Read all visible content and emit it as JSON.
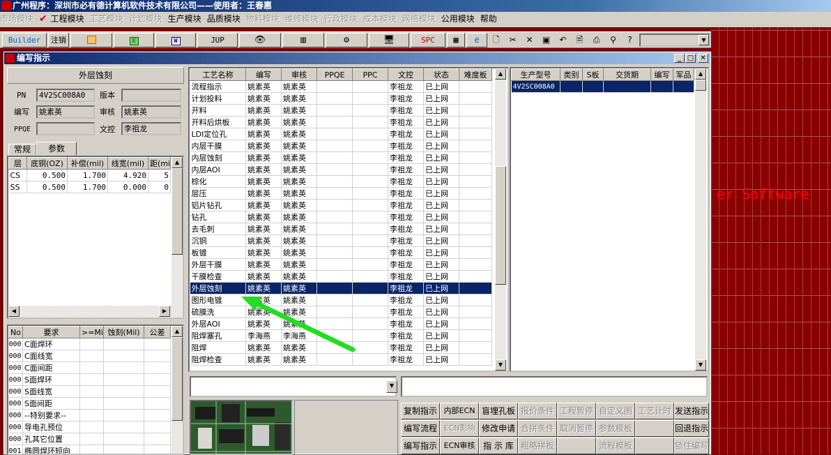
{
  "app": {
    "title": "广州程序：深圳市必有德计算机软件技术有限公司——使用者：王春惠"
  },
  "menu": [
    {
      "label": "市场模块",
      "enabled": false
    },
    {
      "label": "工程模块",
      "enabled": true,
      "checked": true
    },
    {
      "label": "工艺模块",
      "enabled": false
    },
    {
      "label": "计划模块",
      "enabled": false
    },
    {
      "label": "生产模块",
      "enabled": true
    },
    {
      "label": "品质模块",
      "enabled": true
    },
    {
      "label": "物料模块",
      "enabled": false
    },
    {
      "label": "维修模块",
      "enabled": false
    },
    {
      "label": "行政模块",
      "enabled": false
    },
    {
      "label": "成本模块",
      "enabled": false
    },
    {
      "label": "网络模块",
      "enabled": false
    },
    {
      "label": "公用模块",
      "enabled": true
    },
    {
      "label": "帮助",
      "enabled": true
    }
  ],
  "toolbar": {
    "builder": "Builder",
    "logout": "注销",
    "jup": "JUP",
    "spc": "SPC",
    "icons": [
      "new-doc-icon",
      "cut-icon",
      "delete-icon",
      "save-icon",
      "undo-icon",
      "preview-icon",
      "print-icon",
      "binoculars-icon",
      "help-icon"
    ]
  },
  "window": {
    "title": "编写指示"
  },
  "left": {
    "process_name": "外层蚀刻",
    "pn_label": "PN",
    "pn_value": "4V2SC008A0",
    "version_label": "版本",
    "version_value": "",
    "author_label": "编写",
    "author_value": "姚素英",
    "reviewer_label": "审核",
    "reviewer_value": "姚素英",
    "ppqe_label": "PPQE",
    "ppqe_value": "",
    "control_label": "文控",
    "control_value": "李祖龙",
    "tabs": [
      "常规",
      "参数"
    ],
    "params": {
      "headers": [
        "层",
        "底铜(OZ)",
        "补偿(mil)",
        "线宽(mil)",
        "距(mi"
      ],
      "rows": [
        [
          "CS",
          "0.500",
          "1.700",
          "4.920",
          "5"
        ],
        [
          "SS",
          "0.500",
          "1.700",
          "0.000",
          "0"
        ]
      ]
    },
    "reqs": {
      "headers": [
        "No",
        "要求",
        ">=Mil",
        "蚀刻(Mil)",
        "公差"
      ],
      "rows": [
        [
          "000",
          "C面焊环"
        ],
        [
          "000",
          "C面线宽"
        ],
        [
          "000",
          "C面间距"
        ],
        [
          "000",
          "S面焊环"
        ],
        [
          "000",
          "S面线宽"
        ],
        [
          "000",
          "S面间距"
        ],
        [
          "000",
          "--特别要求--"
        ],
        [
          "000",
          "导电孔预位"
        ],
        [
          "000",
          "孔其它位置"
        ],
        [
          "001",
          "椭圆焊环短向"
        ]
      ]
    }
  },
  "process": {
    "headers": [
      "工艺名称",
      "编写",
      "审核",
      "PPQE",
      "PPC",
      "文控",
      "状态",
      "难度板"
    ],
    "selected": 17,
    "rows": [
      [
        "流程指示",
        "姚素英",
        "姚素英",
        "",
        "",
        "李祖龙",
        "已上网"
      ],
      [
        "计划投料",
        "姚素英",
        "姚素英",
        "",
        "",
        "李祖龙",
        "已上网"
      ],
      [
        "开料",
        "姚素英",
        "姚素英",
        "",
        "",
        "李祖龙",
        "已上网"
      ],
      [
        "开料后烘板",
        "姚素英",
        "姚素英",
        "",
        "",
        "李祖龙",
        "已上网"
      ],
      [
        "LDI定位孔",
        "姚素英",
        "姚素英",
        "",
        "",
        "李祖龙",
        "已上网"
      ],
      [
        "内层干膜",
        "姚素英",
        "姚素英",
        "",
        "",
        "李祖龙",
        "已上网"
      ],
      [
        "内层蚀刻",
        "姚素英",
        "姚素英",
        "",
        "",
        "李祖龙",
        "已上网"
      ],
      [
        "内层AOI",
        "姚素英",
        "姚素英",
        "",
        "",
        "李祖龙",
        "已上网"
      ],
      [
        "棕化",
        "姚素英",
        "姚素英",
        "",
        "",
        "李祖龙",
        "已上网"
      ],
      [
        "层压",
        "姚素英",
        "姚素英",
        "",
        "",
        "李祖龙",
        "已上网"
      ],
      [
        "铝片钻孔",
        "姚素英",
        "姚素英",
        "",
        "",
        "李祖龙",
        "已上网"
      ],
      [
        "钻孔",
        "姚素英",
        "姚素英",
        "",
        "",
        "李祖龙",
        "已上网"
      ],
      [
        "去毛刺",
        "姚素英",
        "姚素英",
        "",
        "",
        "李祖龙",
        "已上网"
      ],
      [
        "沉铜",
        "姚素英",
        "姚素英",
        "",
        "",
        "李祖龙",
        "已上网"
      ],
      [
        "板镀",
        "姚素英",
        "姚素英",
        "",
        "",
        "李祖龙",
        "已上网"
      ],
      [
        "外层干膜",
        "姚素英",
        "姚素英",
        "",
        "",
        "李祖龙",
        "已上网"
      ],
      [
        "干膜检查",
        "姚素英",
        "姚素英",
        "",
        "",
        "李祖龙",
        "已上网"
      ],
      [
        "外层蚀刻",
        "姚素英",
        "姚素英",
        "",
        "",
        "李祖龙",
        "已上网"
      ],
      [
        "图形电镀",
        "姚素英",
        "姚素英",
        "",
        "",
        "李祖龙",
        "已上网"
      ],
      [
        "硫膜洗",
        "姚素英",
        "姚素英",
        "",
        "",
        "李祖龙",
        "已上网"
      ],
      [
        "外层AOI",
        "姚素英",
        "姚素英",
        "",
        "",
        "李祖龙",
        "已上网"
      ],
      [
        "阻焊塞孔",
        "李海燕",
        "李海燕",
        "",
        "",
        "李祖龙",
        "已上网"
      ],
      [
        "阻焊",
        "姚素英",
        "姚素英",
        "",
        "",
        "李祖龙",
        "已上网"
      ],
      [
        "阻焊检查",
        "姚素英",
        "姚素英",
        "",
        "",
        "李祖龙",
        "已上网"
      ]
    ]
  },
  "product": {
    "headers": [
      "生产型号",
      "类别",
      "S板",
      "交货期",
      "编写",
      "军品"
    ],
    "rows": [
      [
        "4V2SC008A0",
        "",
        "",
        "",
        "",
        ""
      ]
    ]
  },
  "buttons": [
    [
      "复制指示",
      "内部ECN",
      "盲埋孔板",
      "报价条件",
      "工程暂停",
      "自定义图",
      "工艺计时",
      "发送指示"
    ],
    [
      "编写流程",
      "ECN影响",
      "修改申请",
      "合拼条件",
      "取消暂停",
      "参数模板",
      "",
      "回退指示"
    ],
    [
      "编写指示",
      "ECN审核",
      "指 示 库",
      "粗略拼板",
      "",
      "流程模板",
      "",
      "锁住编写"
    ]
  ],
  "buttons_enabled": [
    [
      true,
      true,
      true,
      false,
      false,
      false,
      false,
      true
    ],
    [
      true,
      false,
      true,
      false,
      false,
      false,
      false,
      true
    ],
    [
      true,
      true,
      true,
      false,
      false,
      false,
      false,
      false
    ]
  ],
  "desktop": {
    "text": "er Software"
  },
  "colors": {
    "titlebar": "#0a246a",
    "selection": "#0a246a",
    "arrow": "#22dd22",
    "desktop": "#8a0000"
  }
}
